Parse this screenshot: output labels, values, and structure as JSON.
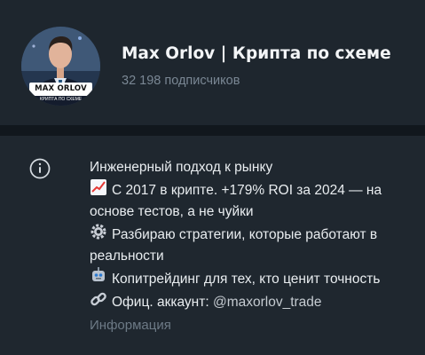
{
  "header": {
    "avatar": {
      "badge_text": "MAX ORLOV",
      "sub_text": "КРИПТА ПО СХЕМЕ"
    },
    "title": "Max Orlov | Крипта по схеме",
    "subscribers": "32 198 подписчиков"
  },
  "info": {
    "icon": "info-icon",
    "heading": "Инженерный подход к рынку",
    "items": [
      {
        "emoji": "chart-increasing-emoji",
        "text": "С 2017 в крипте. +179% ROI за 2024 — на основе тестов, а не чуйки"
      },
      {
        "emoji": "gear-emoji",
        "text": "Разбираю стратегии, которые работают в реальности"
      },
      {
        "emoji": "robot-emoji",
        "text": "Копитрейдинг для тех, кто ценит точность"
      }
    ],
    "official_prefix": "Офиц. аккаунт:",
    "official_handle": "@maxorlov_trade",
    "official_emoji": "link-emoji",
    "label": "Информация"
  },
  "colors": {
    "background": "#1f272f",
    "divider": "#11171d",
    "title": "#f2f4f6",
    "muted": "#7a8794"
  }
}
